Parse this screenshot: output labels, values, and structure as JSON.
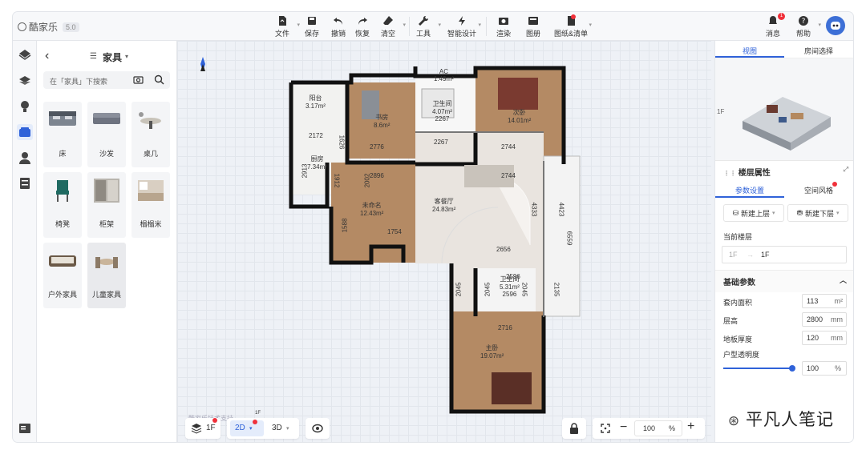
{
  "app": {
    "name": "酷家乐",
    "version": "5.0"
  },
  "toolbar": {
    "items": [
      {
        "label": "文件",
        "icon": "file-icon"
      },
      {
        "label": "保存",
        "icon": "save-icon"
      },
      {
        "label": "撤销",
        "icon": "undo-icon"
      },
      {
        "label": "恢复",
        "icon": "redo-icon"
      },
      {
        "label": "清空",
        "icon": "eraser-icon"
      },
      {
        "label": "工具",
        "icon": "wrench-icon"
      },
      {
        "label": "智能设计",
        "icon": "lightning-icon"
      },
      {
        "label": "渲染",
        "icon": "camera-icon"
      },
      {
        "label": "图册",
        "icon": "album-icon"
      },
      {
        "label": "图纸&清单",
        "icon": "drawing-list-icon"
      }
    ],
    "right": [
      {
        "label": "消息",
        "icon": "bell-icon",
        "badge": "1"
      },
      {
        "label": "帮助",
        "icon": "help-icon"
      }
    ]
  },
  "left_nav": [
    "structure-icon",
    "floor-layer-icon",
    "light-icon",
    "furniture-icon",
    "user-icon",
    "cabinet-icon"
  ],
  "catalog": {
    "category": "家具",
    "search_placeholder": "在「家具」下搜索",
    "items": [
      "床",
      "沙发",
      "桌几",
      "椅凳",
      "柜架",
      "榻榻米",
      "户外家具",
      "儿童家具"
    ]
  },
  "floorplan": {
    "rooms": [
      {
        "name": "AC",
        "area": "1.49m²"
      },
      {
        "name": "阳台",
        "area": "3.17m²",
        "dim": "2170"
      },
      {
        "name": "卫生间",
        "area": "4.07m²",
        "dim": "2267"
      },
      {
        "name": "书房",
        "area": "8.6m²"
      },
      {
        "name": "次卧",
        "area": "14.01m²"
      },
      {
        "name": "厨房",
        "area": "7.34m²"
      },
      {
        "name": "未命名",
        "area": "12.43m²"
      },
      {
        "name": "客餐厅",
        "area": "24.83m²"
      },
      {
        "name": "卫生间",
        "area": "5.31m²",
        "dim": "2596"
      },
      {
        "name": "主卧",
        "area": "19.07m²"
      }
    ],
    "dims": [
      "2172",
      "1626",
      "2776",
      "2267",
      "2744",
      "2913",
      "1912",
      "2002",
      "2896",
      "2744",
      "4333",
      "4423",
      "6559",
      "1588",
      "1754",
      "2656",
      "2045",
      "2045",
      "2045",
      "2596",
      "2135",
      "2716"
    ]
  },
  "watermark_small": "酷家乐技术支持",
  "bottom_left": {
    "floor": "1F",
    "mode_2d": "2D",
    "mode_3d": "3D"
  },
  "bottom_right": {
    "zoom": "100",
    "unit": "%"
  },
  "bottom_label": "1F",
  "right_panel": {
    "tabs": [
      "视图",
      "房间选择"
    ],
    "view_label": "1F",
    "section_title": "楼层属性",
    "subtabs": [
      "参数设置",
      "空间风格"
    ],
    "btn_up": "新建上层",
    "btn_down": "新建下层",
    "current_floor_label": "当前楼层",
    "floor_from": "1F",
    "floor_to": "1F",
    "basic_title": "基础参数",
    "params": [
      {
        "label": "套内面积",
        "value": "113",
        "unit": "m²"
      },
      {
        "label": "层高",
        "value": "2800",
        "unit": "mm"
      },
      {
        "label": "地板厚度",
        "value": "120",
        "unit": "mm"
      }
    ],
    "transparency_label": "户型透明度",
    "transparency_value": "100",
    "transparency_unit": "%"
  },
  "watermark": "平凡人笔记"
}
